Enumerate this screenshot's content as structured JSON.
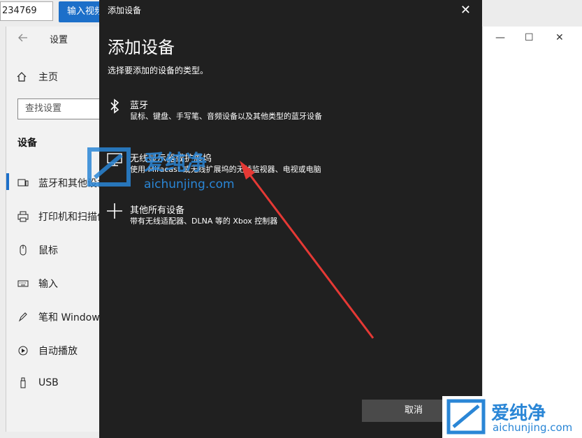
{
  "browser": {
    "input_value": "234769",
    "button_label": "输入视频"
  },
  "settings": {
    "title": "设置",
    "home_label": "主页",
    "search_placeholder": "查找设置",
    "section_label": "设备",
    "nav_items": [
      {
        "label": "蓝牙和其他设备",
        "icon": "bluetooth-devices-icon"
      },
      {
        "label": "打印机和扫描仪",
        "icon": "printer-icon"
      },
      {
        "label": "鼠标",
        "icon": "mouse-icon"
      },
      {
        "label": "输入",
        "icon": "keyboard-icon"
      },
      {
        "label": "笔和 Windows Ink",
        "icon": "pen-icon"
      },
      {
        "label": "自动播放",
        "icon": "autoplay-icon"
      },
      {
        "label": "USB",
        "icon": "usb-icon"
      }
    ]
  },
  "dialog": {
    "window_title": "添加设备",
    "heading": "添加设备",
    "subtitle": "选择要添加的设备的类型。",
    "options": [
      {
        "name": "蓝牙",
        "desc": "鼠标、键盘、手写笔、音频设备以及其他类型的蓝牙设备",
        "icon": "bluetooth-icon"
      },
      {
        "name": "无线显示器或扩展坞",
        "desc": "使用 Miracast 或无线扩展坞的无线监视器、电视或电脑",
        "icon": "monitor-icon"
      },
      {
        "name": "其他所有设备",
        "desc": "带有无线适配器、DLNA 等的 Xbox 控制器",
        "icon": "plus-icon"
      }
    ],
    "cancel_label": "取消"
  },
  "watermark": {
    "logo_text": "爱纯净",
    "url": "aichunjing.com"
  },
  "colors": {
    "dialog_bg": "#202020",
    "accent": "#1c6fc9",
    "arrow": "#e53935",
    "watermark": "#2a86d6"
  }
}
